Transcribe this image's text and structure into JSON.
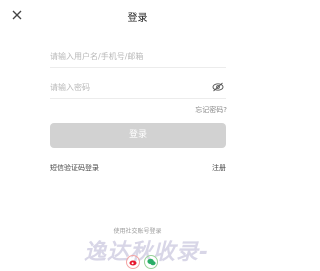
{
  "header": {
    "title": "登录",
    "close_icon": "close-icon"
  },
  "form": {
    "account": {
      "placeholder": "请输入用户名/手机号/邮箱",
      "value": ""
    },
    "password": {
      "placeholder": "请输入密码",
      "value": "",
      "toggle_icon": "eye-off-icon"
    },
    "forgot_label": "忘记密码?",
    "login_label": "登录",
    "login_bg": "#d2d2d2"
  },
  "links": {
    "sms_login": "短信验证码登录",
    "register": "注册"
  },
  "social": {
    "title": "使用社交账号登录",
    "icons": [
      "weibo-icon",
      "wechat-icon"
    ],
    "weibo_color": "#e6162d",
    "wechat_color": "#2aae67"
  },
  "watermark": {
    "text": "逸达秋收录-"
  }
}
